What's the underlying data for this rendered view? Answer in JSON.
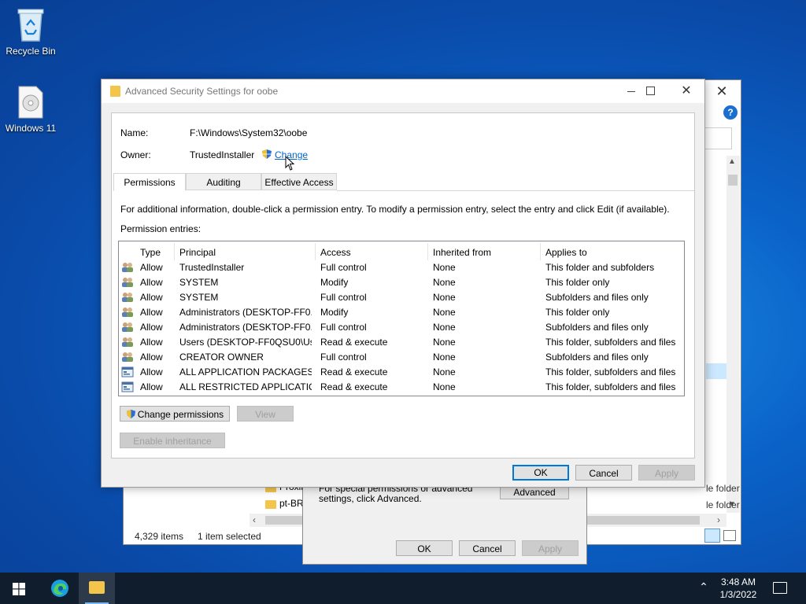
{
  "desktop": {
    "icons": [
      {
        "label": "Recycle Bin",
        "icon": "recycle-bin-icon"
      },
      {
        "label": "Windows 11",
        "icon": "disc-image-icon"
      }
    ]
  },
  "explorer_bg": {
    "status_items": "4,329 items",
    "status_selected": "1 item selected",
    "folders": [
      "Proxim",
      "pt-BR"
    ],
    "type_col": [
      "le folder",
      "le folder"
    ]
  },
  "props_bg": {
    "hint": "For special permissions or advanced settings, click Advanced.",
    "advanced_btn": "Advanced",
    "ok": "OK",
    "cancel": "Cancel",
    "apply": "Apply"
  },
  "dialog": {
    "title": "Advanced Security Settings for oobe",
    "name_label": "Name:",
    "name_value": "F:\\Windows\\System32\\oobe",
    "owner_label": "Owner:",
    "owner_value": "TrustedInstaller",
    "change_link": "Change",
    "tabs": [
      "Permissions",
      "Auditing",
      "Effective Access"
    ],
    "info": "For additional information, double-click a permission entry. To modify a permission entry, select the entry and click Edit (if available).",
    "entries_label": "Permission entries:",
    "columns": [
      "Type",
      "Principal",
      "Access",
      "Inherited from",
      "Applies to"
    ],
    "rows": [
      {
        "type": "Allow",
        "principal": "TrustedInstaller",
        "access": "Full control",
        "inherited": "None",
        "applies": "This folder and subfolders",
        "icon": "users-icon"
      },
      {
        "type": "Allow",
        "principal": "SYSTEM",
        "access": "Modify",
        "inherited": "None",
        "applies": "This folder only",
        "icon": "users-icon"
      },
      {
        "type": "Allow",
        "principal": "SYSTEM",
        "access": "Full control",
        "inherited": "None",
        "applies": "Subfolders and files only",
        "icon": "users-icon"
      },
      {
        "type": "Allow",
        "principal": "Administrators (DESKTOP-FF0...",
        "access": "Modify",
        "inherited": "None",
        "applies": "This folder only",
        "icon": "users-icon"
      },
      {
        "type": "Allow",
        "principal": "Administrators (DESKTOP-FF0...",
        "access": "Full control",
        "inherited": "None",
        "applies": "Subfolders and files only",
        "icon": "users-icon"
      },
      {
        "type": "Allow",
        "principal": "Users (DESKTOP-FF0QSU0\\Us...",
        "access": "Read & execute",
        "inherited": "None",
        "applies": "This folder, subfolders and files",
        "icon": "users-icon"
      },
      {
        "type": "Allow",
        "principal": "CREATOR OWNER",
        "access": "Full control",
        "inherited": "None",
        "applies": "Subfolders and files only",
        "icon": "users-icon"
      },
      {
        "type": "Allow",
        "principal": "ALL APPLICATION PACKAGES",
        "access": "Read & execute",
        "inherited": "None",
        "applies": "This folder, subfolders and files",
        "icon": "package-icon"
      },
      {
        "type": "Allow",
        "principal": "ALL RESTRICTED APPLICATIO...",
        "access": "Read & execute",
        "inherited": "None",
        "applies": "This folder, subfolders and files",
        "icon": "package-icon"
      }
    ],
    "change_permissions_btn": "Change permissions",
    "view_btn": "View",
    "enable_inheritance_btn": "Enable inheritance",
    "ok_btn": "OK",
    "cancel_btn": "Cancel",
    "apply_btn": "Apply"
  },
  "taskbar": {
    "time": "3:48 AM",
    "date": "1/3/2022"
  },
  "colors": {
    "accent": "#0078d7",
    "link": "#0066cc",
    "taskbar": "#101d2d"
  }
}
